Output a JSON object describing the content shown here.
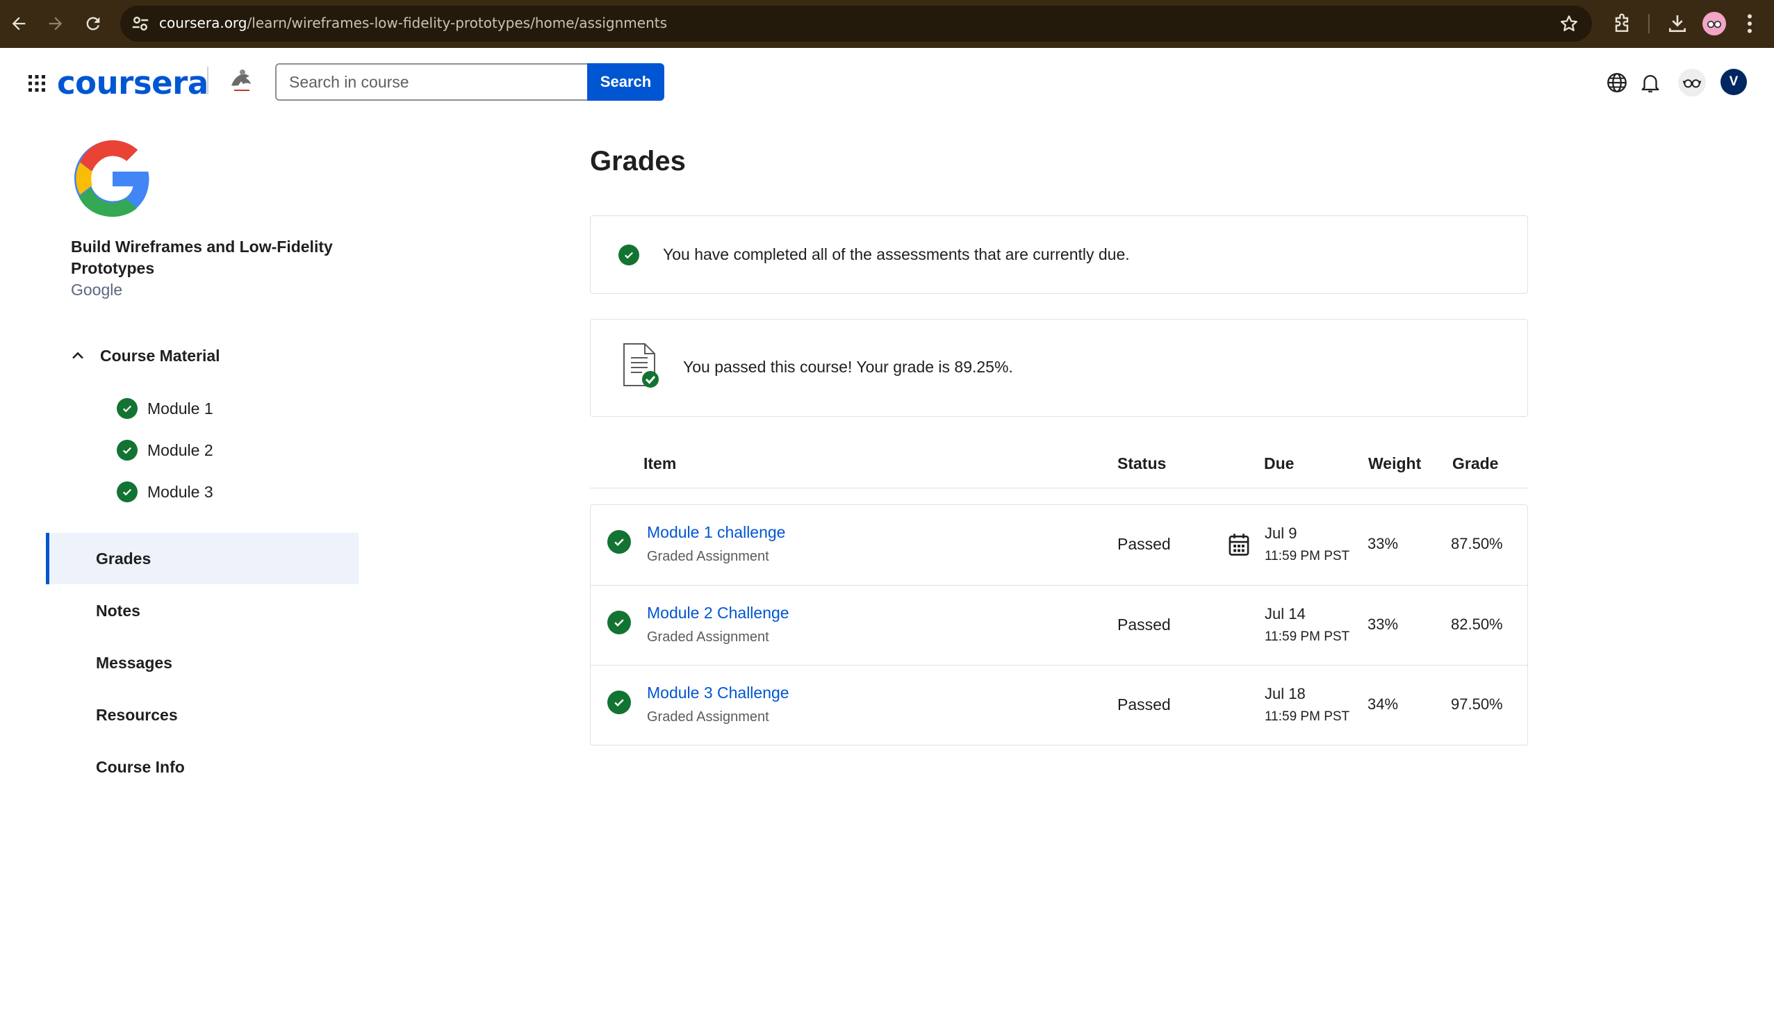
{
  "browser": {
    "url_domain": "coursera.org",
    "url_path": "/learn/wireframes-low-fidelity-prototypes/home/assignments"
  },
  "header": {
    "logo": "coursera",
    "search_placeholder": "Search in course",
    "search_button": "Search",
    "avatar_initial": "V"
  },
  "sidebar": {
    "course_title": "Build Wireframes and Low-Fidelity Prototypes",
    "course_org": "Google",
    "course_material_label": "Course Material",
    "modules": [
      "Module 1",
      "Module 2",
      "Module 3"
    ],
    "nav": [
      "Grades",
      "Notes",
      "Messages",
      "Resources",
      "Course Info"
    ],
    "active_nav": "Grades"
  },
  "main": {
    "title": "Grades",
    "completed_message": "You have completed all of the assessments that are currently due.",
    "passed_message": "You passed this course! Your grade is 89.25%.",
    "columns": {
      "item": "Item",
      "status": "Status",
      "due": "Due",
      "weight": "Weight",
      "grade": "Grade"
    },
    "rows": [
      {
        "name": "Module 1 challenge",
        "type": "Graded Assignment",
        "status": "Passed",
        "due_date": "Jul 9",
        "due_time": "11:59 PM PST",
        "weight": "33%",
        "grade": "87.50%"
      },
      {
        "name": "Module 2 Challenge",
        "type": "Graded Assignment",
        "status": "Passed",
        "due_date": "Jul 14",
        "due_time": "11:59 PM PST",
        "weight": "33%",
        "grade": "82.50%"
      },
      {
        "name": "Module 3 Challenge",
        "type": "Graded Assignment",
        "status": "Passed",
        "due_date": "Jul 18",
        "due_time": "11:59 PM PST",
        "weight": "34%",
        "grade": "97.50%"
      }
    ]
  },
  "colors": {
    "brand": "#0056d2",
    "success": "#137333",
    "chrome_bar": "#3b2a13"
  }
}
